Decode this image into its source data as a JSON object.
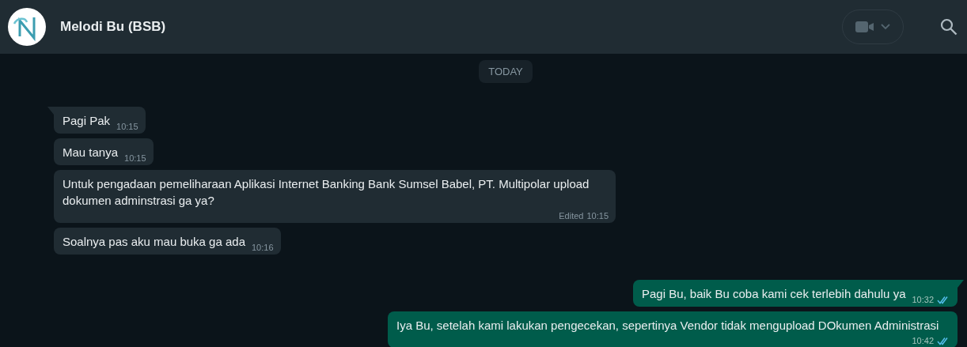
{
  "header": {
    "contact_name": "Melodi Bu (BSB)"
  },
  "date_divider": "TODAY",
  "messages": [
    {
      "kind": "incoming",
      "text": "Pagi Pak",
      "time": "10:15",
      "tail": true
    },
    {
      "kind": "incoming",
      "text": "Mau tanya",
      "time": "10:15",
      "tail": false
    },
    {
      "kind": "incoming",
      "text": "Untuk pengadaan pemeliharaan Aplikasi Internet Banking Bank Sumsel Babel, PT. Multipolar upload dokumen adminstrasi ga ya?",
      "time": "10:15",
      "edited_label": "Edited",
      "tail": false
    },
    {
      "kind": "incoming",
      "text": "Soalnya pas aku mau buka ga ada",
      "time": "10:16",
      "tail": false
    },
    {
      "kind": "outgoing",
      "text": "Pagi Bu, baik Bu coba kami cek terlebih dahulu ya",
      "time": "10:32",
      "read": true,
      "tail": true
    },
    {
      "kind": "outgoing",
      "text": "Iya Bu, setelah kami lakukan pengecekan, sepertinya Vendor tidak mengupload DOkumen Administrasi",
      "time": "10:42",
      "read": true,
      "tail": false
    }
  ]
}
